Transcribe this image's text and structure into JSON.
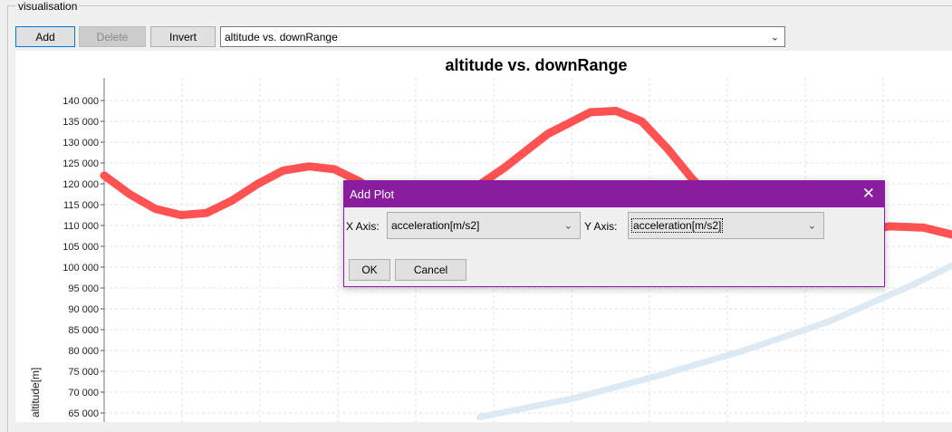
{
  "group": {
    "title": "visualisation"
  },
  "toolbar": {
    "add_label": "Add",
    "delete_label": "Delete",
    "invert_label": "Invert",
    "plot_select_value": "altitude vs. downRange"
  },
  "chart_data": {
    "type": "line",
    "title": "altitude vs. downRange",
    "ylabel": "altitude[m]",
    "xlabel": "",
    "ylim": [
      64000,
      142000
    ],
    "y_ticks": [
      "140 000",
      "135 000",
      "130 000",
      "125 000",
      "120 000",
      "115 000",
      "110 000",
      "105 000",
      "100 000",
      "95 000",
      "90 000",
      "85 000",
      "80 000",
      "75 000",
      "70 000",
      "65 000"
    ],
    "grid": true,
    "series": [
      {
        "color": "#ff5252",
        "points": [
          [
            0,
            122000
          ],
          [
            3,
            117500
          ],
          [
            6,
            114000
          ],
          [
            9,
            112500
          ],
          [
            12,
            113000
          ],
          [
            15,
            116000
          ],
          [
            18,
            120000
          ],
          [
            21,
            123200
          ],
          [
            24,
            124200
          ],
          [
            27,
            123500
          ],
          [
            30,
            120500
          ],
          [
            33,
            116000
          ],
          [
            37,
            114500
          ],
          [
            42,
            117000
          ],
          [
            47,
            124000
          ],
          [
            52,
            132000
          ],
          [
            57,
            137200
          ],
          [
            60,
            137500
          ],
          [
            63,
            135000
          ],
          [
            66,
            128500
          ],
          [
            69,
            121000
          ],
          [
            72,
            114500
          ],
          [
            75,
            110000
          ],
          [
            79,
            107500
          ],
          [
            83,
            107200
          ],
          [
            87,
            108000
          ],
          [
            92,
            109800
          ],
          [
            96,
            109500
          ],
          [
            100,
            107500
          ]
        ]
      },
      {
        "color": "#dde9f3",
        "points": [
          [
            44,
            64000
          ],
          [
            55,
            68500
          ],
          [
            65,
            74000
          ],
          [
            75,
            80000
          ],
          [
            85,
            87000
          ],
          [
            95,
            96000
          ],
          [
            100,
            101000
          ]
        ]
      }
    ]
  },
  "dialog": {
    "title": "Add Plot",
    "x_axis_label": "X Axis:",
    "x_axis_value": "acceleration[m/s2]",
    "y_axis_label": "Y Axis:",
    "y_axis_value": "acceleration[m/s2]",
    "ok_label": "OK",
    "cancel_label": "Cancel"
  }
}
